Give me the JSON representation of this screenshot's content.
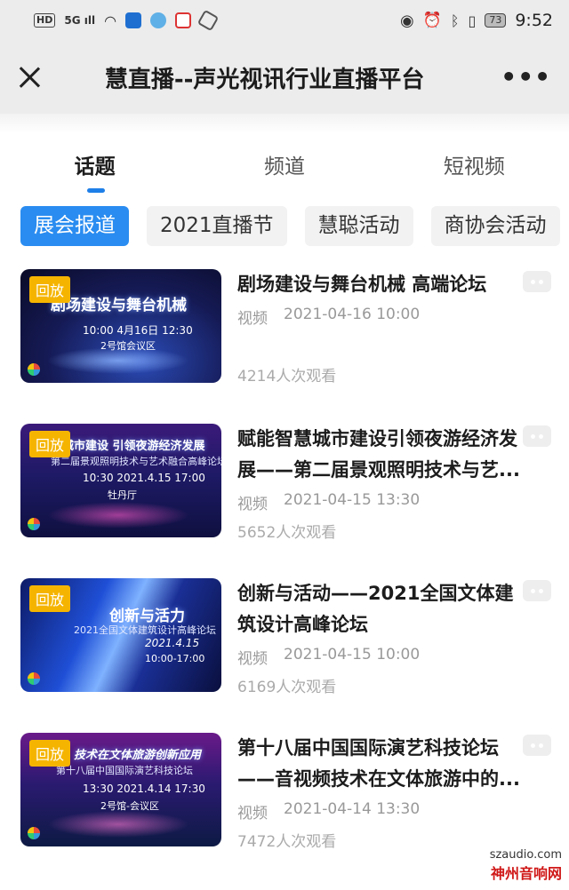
{
  "status_bar": {
    "left_labels": [
      "HD",
      "5G",
      "ıll"
    ],
    "battery": "73",
    "time": "9:52",
    "icons": [
      "hd-icon",
      "signal-icon",
      "wifi-icon",
      "app-icon",
      "eye-icon",
      "alarm-icon",
      "bluetooth-icon",
      "vibrate-icon",
      "battery-icon"
    ]
  },
  "header": {
    "title": "慧直播--声光视讯行业直播平台",
    "more": "•••"
  },
  "tabs": [
    {
      "label": "话题",
      "active": true
    },
    {
      "label": "频道",
      "active": false
    },
    {
      "label": "短视频",
      "active": false
    }
  ],
  "chips": [
    {
      "label": "展会报道",
      "active": true
    },
    {
      "label": "2021直播节",
      "active": false
    },
    {
      "label": "慧聪活动",
      "active": false
    },
    {
      "label": "商协会活动",
      "active": false
    }
  ],
  "items": [
    {
      "badge": "回放",
      "title": "剧场建设与舞台机械 高端论坛",
      "category": "视频",
      "datetime": "2021-04-16 10:00",
      "views": "4214人次观看",
      "thumb": {
        "head": "剧场建设与舞台机械",
        "sub": "",
        "date": "10:00  4月16日  12:30",
        "venue": "2号馆会议区"
      }
    },
    {
      "badge": "回放",
      "title": "赋能智慧城市建设引领夜游经济发展——第二届景观照明技术与艺...",
      "category": "视频",
      "datetime": "2021-04-15 13:30",
      "views": "5652人次观看",
      "thumb": {
        "head": "慧城市建设 引领夜游经济发展",
        "sub": "第二届景观照明技术与艺术融合高峰论坛",
        "date": "10:30  2021.4.15  17:00",
        "venue": "牡丹厅"
      }
    },
    {
      "badge": "回放",
      "title": "创新与活动——2021全国文体建筑设计高峰论坛",
      "category": "视频",
      "datetime": "2021-04-15 10:00",
      "views": "6169人次观看",
      "thumb": {
        "head": "创新与活力",
        "sub": "2021全国文体建筑设计高峰论坛",
        "date": "2021.4.15",
        "venue": "10:00-17:00"
      }
    },
    {
      "badge": "回放",
      "title": "第十八届中国国际演艺科技论坛——音视频技术在文体旅游中的...",
      "category": "视频",
      "datetime": "2021-04-14 13:30",
      "views": "7472人次观看",
      "thumb": {
        "head": "技术在文体旅游创新应用",
        "sub": "第十八届中国国际演艺科技论坛",
        "date": "13:30  2021.4.14  17:30",
        "venue": "2号馆-会议区"
      }
    }
  ],
  "watermark": {
    "url": "szaudio.com",
    "name": "神州音响网"
  },
  "colors": {
    "accent": "#2a8cf0",
    "badge": "#f5b400",
    "title_bar_bg": "#ececec"
  }
}
